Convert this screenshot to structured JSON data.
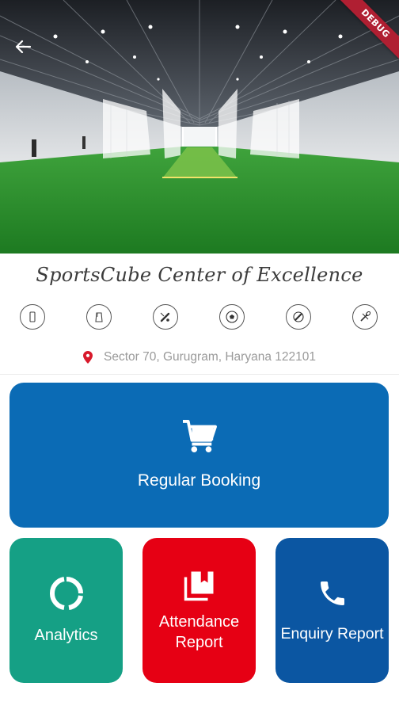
{
  "app": {
    "title": "SportsCube Center of Excellence",
    "debug_banner": "DEBUG"
  },
  "sport_icons": [
    {
      "name": "phone-icon"
    },
    {
      "name": "kit-bag-icon"
    },
    {
      "name": "cricket-icon"
    },
    {
      "name": "football-icon"
    },
    {
      "name": "bat-icon"
    },
    {
      "name": "badminton-icon"
    }
  ],
  "address": {
    "icon": "location-pin-icon",
    "text": "Sector 70, Gurugram, Haryana 122101"
  },
  "buttons": {
    "regular_booking": {
      "label": "Regular Booking",
      "icon": "cart-icon"
    },
    "analytics": {
      "label": "Analytics",
      "icon": "analytics-ring-icon"
    },
    "attendance": {
      "label": "Attendance Report",
      "icon": "library-books-icon"
    },
    "enquiry": {
      "label": "Enquiry Report",
      "icon": "phone-call-icon"
    }
  },
  "colors": {
    "regular_booking": "#0b6bb5",
    "analytics": "#15a085",
    "attendance": "#e60014",
    "enquiry": "#0b56a2",
    "pin": "#d8192b",
    "debug": "#b01f32"
  }
}
